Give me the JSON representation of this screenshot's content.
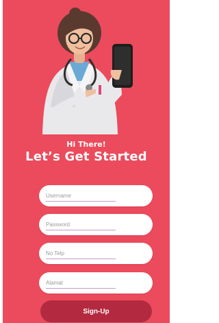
{
  "colors": {
    "background": "#eb4b5c",
    "button": "#b32a40",
    "field": "#ffffff",
    "underline": "#c49ac8"
  },
  "hero": {
    "illustration": "doctor-holding-phone-illustration"
  },
  "greeting": "Hi There!",
  "headline": "Let’s Get Started",
  "form": {
    "username_placeholder": "Username",
    "password_placeholder": "Password",
    "phone_placeholder": "No Telp",
    "address_placeholder": "Alamat"
  },
  "signup_label": "Sign-Up"
}
